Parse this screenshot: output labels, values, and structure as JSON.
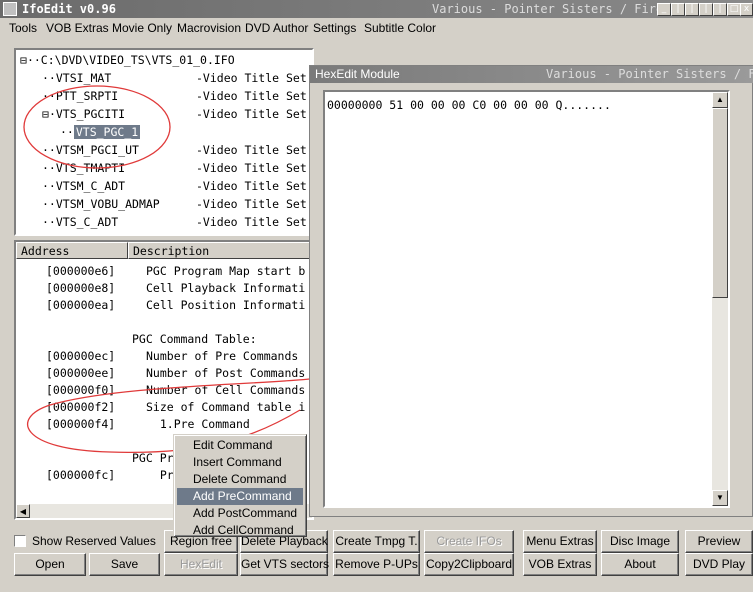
{
  "window": {
    "title": "IfoEdit v0.96",
    "title_right": "Various - Pointer Sisters / Fire",
    "caption_buttons": [
      "_",
      "|",
      "|",
      "|",
      "|",
      "□",
      "x"
    ]
  },
  "menu": [
    "Tools",
    "VOB Extras",
    "Movie Only",
    "Macrovision",
    "DVD Author",
    "Settings",
    "Subtitle Color"
  ],
  "tree": {
    "root": "C:\\DVD\\VIDEO_TS\\VTS_01_0.IFO",
    "items": [
      {
        "name": "VTSI_MAT",
        "desc": "-Video Title Set"
      },
      {
        "name": "PTT_SRPTI",
        "desc": "-Video Title Set"
      },
      {
        "name": "VTS_PGCITI",
        "desc": "-Video Title Set"
      },
      {
        "name": "VTSM_PGCI_UT",
        "desc": "-Video Title Set"
      },
      {
        "name": "VTS_TMAPTI",
        "desc": "-Video Title Set"
      },
      {
        "name": "VTSM_C_ADT",
        "desc": "-Video Title Set"
      },
      {
        "name": "VTSM_VOBU_ADMAP",
        "desc": "-Video Title Set"
      },
      {
        "name": "VTS_C_ADT",
        "desc": "-Video Title Set"
      }
    ],
    "child": "VTS_PGC_1"
  },
  "details": {
    "headers": [
      "Address",
      "Description"
    ],
    "rows": [
      {
        "addr": "[000000e6]",
        "desc": "PGC Program Map start b"
      },
      {
        "addr": "[000000e8]",
        "desc": "Cell Playback Informati"
      },
      {
        "addr": "[000000ea]",
        "desc": "Cell Position Informati"
      },
      {
        "addr": "",
        "desc": ""
      },
      {
        "addr": "",
        "desc": "PGC Command Table:"
      },
      {
        "addr": "[000000ec]",
        "desc": "Number of Pre Commands"
      },
      {
        "addr": "[000000ee]",
        "desc": "Number of Post Commands"
      },
      {
        "addr": "[000000f0]",
        "desc": "Number of Cell Commands"
      },
      {
        "addr": "[000000f2]",
        "desc": "Size of Command table i"
      },
      {
        "addr": "[000000f4]",
        "desc": "  1.Pre Command"
      },
      {
        "addr": "",
        "desc": ""
      },
      {
        "addr": "",
        "desc": "PGC Pr"
      },
      {
        "addr": "[000000fc]",
        "desc": "  Pr"
      }
    ]
  },
  "context_menu": {
    "items": [
      "Edit Command",
      "Insert Command",
      "Delete Command",
      "Add PreCommand",
      "Add PostCommand",
      "Add CellCommand"
    ],
    "selected": "Add PreCommand"
  },
  "hexedit": {
    "title": "HexEdit Module",
    "title_right": "Various - Pointer Sisters / Fi",
    "line": "00000000 51 00 00 00 C0 00 00 00 Q......."
  },
  "buttons": {
    "show_reserved": "Show Reserved Values",
    "region_free": "Region free",
    "delete_playback": "Delete Playback",
    "create_tmpg": "Create Tmpg T.",
    "create_ifos": "Create IFOs",
    "menu_extras": "Menu Extras",
    "disc_image": "Disc Image",
    "preview": "Preview",
    "open": "Open",
    "save": "Save",
    "hexedit": "HexEdit",
    "get_vts": "Get VTS sectors",
    "remove_pups": "Remove P-UPs",
    "copy2clip": "Copy2Clipboard",
    "vob_extras": "VOB Extras",
    "about": "About",
    "dvd_play": "DVD Play"
  },
  "colors": {
    "annotation": "#e03a3a",
    "selection": "#6e7a8a"
  }
}
